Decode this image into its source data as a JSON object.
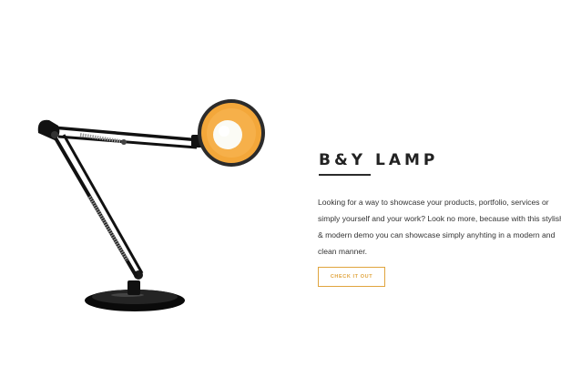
{
  "product": {
    "title": "B&Y LAMP",
    "description": "Looking for a way to showcase your products, portfolio, services or simply yourself and your work? Look no more, because with this stylish & modern demo you can showcase simply anyhting in a modern and clean manner.",
    "cta_label": "CHECK IT OUT"
  },
  "colors": {
    "accent": "#e0a43e",
    "heading": "#222222",
    "body_text": "#333333",
    "background": "#ffffff"
  },
  "image": {
    "subject": "lamp-image"
  }
}
